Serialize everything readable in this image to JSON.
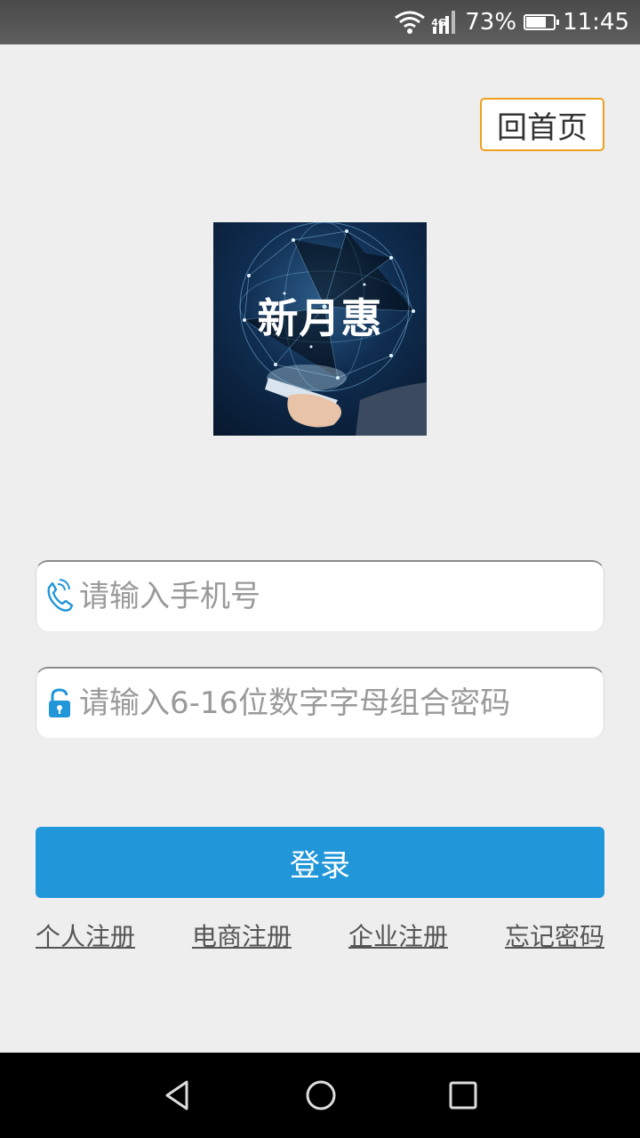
{
  "status_bar": {
    "network": "4G",
    "battery": "73%",
    "battery_level": 0.73,
    "time": "11:45"
  },
  "header": {
    "home_label": "回首页"
  },
  "logo": {
    "text": "新月惠"
  },
  "form": {
    "phone_placeholder": "请输入手机号",
    "password_placeholder": "请输入6-16位数字字母组合密码",
    "login_label": "登录"
  },
  "links": {
    "personal_register": "个人注册",
    "ecommerce_register": "电商注册",
    "enterprise_register": "企业注册",
    "forgot_password": "忘记密码"
  },
  "colors": {
    "accent": "#2196d9",
    "home_border": "#f0a020"
  }
}
